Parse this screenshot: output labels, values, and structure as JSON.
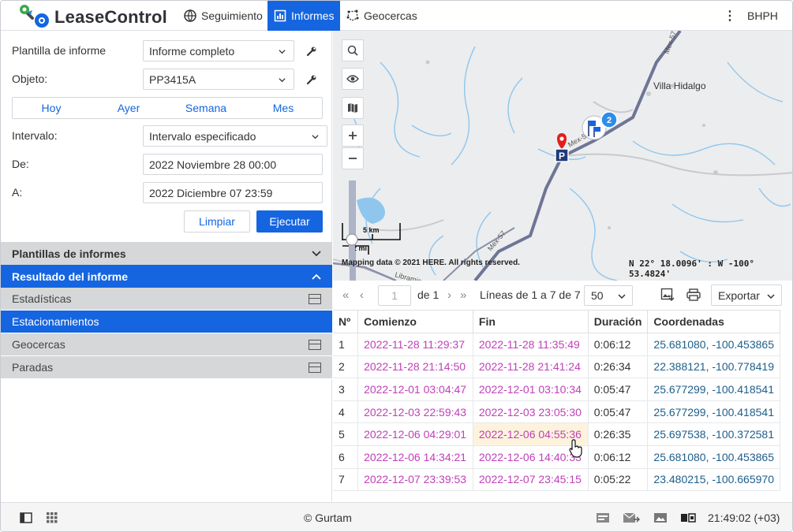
{
  "app": {
    "brand": "LeaseControl",
    "user": "BHPH"
  },
  "nav": {
    "items": [
      {
        "label": "Seguimiento",
        "icon": "globe-icon"
      },
      {
        "label": "Informes",
        "icon": "report-icon",
        "active": true
      },
      {
        "label": "Geocercas",
        "icon": "geofence-icon"
      }
    ],
    "more": "⋮"
  },
  "form": {
    "template_label": "Plantilla de informe",
    "template_value": "Informe completo",
    "object_label": "Objeto:",
    "object_value": "PP3415A",
    "periods": [
      "Hoy",
      "Ayer",
      "Semana",
      "Mes"
    ],
    "interval_label": "Intervalo:",
    "interval_value": "Intervalo especificado",
    "from_label": "De:",
    "from_value": "2022 Noviembre 28 00:00",
    "to_label": "A:",
    "to_value": "2022 Diciembre 07 23:59",
    "clear_label": "Limpiar",
    "run_label": "Ejecutar"
  },
  "sections": {
    "templates": "Plantillas de informes",
    "result": "Resultado del informe",
    "items": [
      "Estadísticas",
      "Estacionamientos",
      "Geocercas",
      "Paradas"
    ],
    "active_item": "Estacionamientos"
  },
  "map": {
    "town": "Villa Hidalgo",
    "road_label": "Mex-57",
    "road_label_2": "Mex-5",
    "street_label": "Libramie",
    "scale_km": "5 km",
    "scale_mi": "2 mi",
    "attribution": "Mapping data © 2021 HERE. All rights reserved.",
    "coordinates": "N 22° 18.0096' : W -100° 53.4824'",
    "cluster_count": "2",
    "parking_letter": "P"
  },
  "table_toolbar": {
    "page_value": "1",
    "page_of": "de 1",
    "lines_info": "Líneas de 1 a 7 de 7",
    "per_page": "50",
    "export_label": "Exportar"
  },
  "table": {
    "headers": [
      "Nº",
      "Comienzo",
      "Fin",
      "Duración",
      "Coordenadas"
    ],
    "rows": [
      [
        "1",
        "2022-11-28 11:29:37",
        "2022-11-28 11:35:49",
        "0:06:12",
        "25.681080, -100.453865"
      ],
      [
        "2",
        "2022-11-28 21:14:50",
        "2022-11-28 21:41:24",
        "0:26:34",
        "22.388121, -100.778419"
      ],
      [
        "3",
        "2022-12-01 03:04:47",
        "2022-12-01 03:10:34",
        "0:05:47",
        "25.677299, -100.418541"
      ],
      [
        "4",
        "2022-12-03 22:59:43",
        "2022-12-03 23:05:30",
        "0:05:47",
        "25.677299, -100.418541"
      ],
      [
        "5",
        "2022-12-06 04:29:01",
        "2022-12-06 04:55:36",
        "0:26:35",
        "25.697538, -100.372581"
      ],
      [
        "6",
        "2022-12-06 14:34:21",
        "2022-12-06 14:40:33",
        "0:06:12",
        "25.681080, -100.453865"
      ],
      [
        "7",
        "2022-12-07 23:39:53",
        "2022-12-07 23:45:15",
        "0:05:22",
        "23.480215, -100.665970"
      ]
    ]
  },
  "footer": {
    "copyright": "© Gurtam",
    "clock": "21:49:02 (+03)"
  },
  "colors": {
    "accent": "#1565e0",
    "time_text": "#c040b8",
    "coord_text": "#1d5e8a",
    "highlight": "#fdf3dc",
    "pin_red": "#e0201c"
  }
}
